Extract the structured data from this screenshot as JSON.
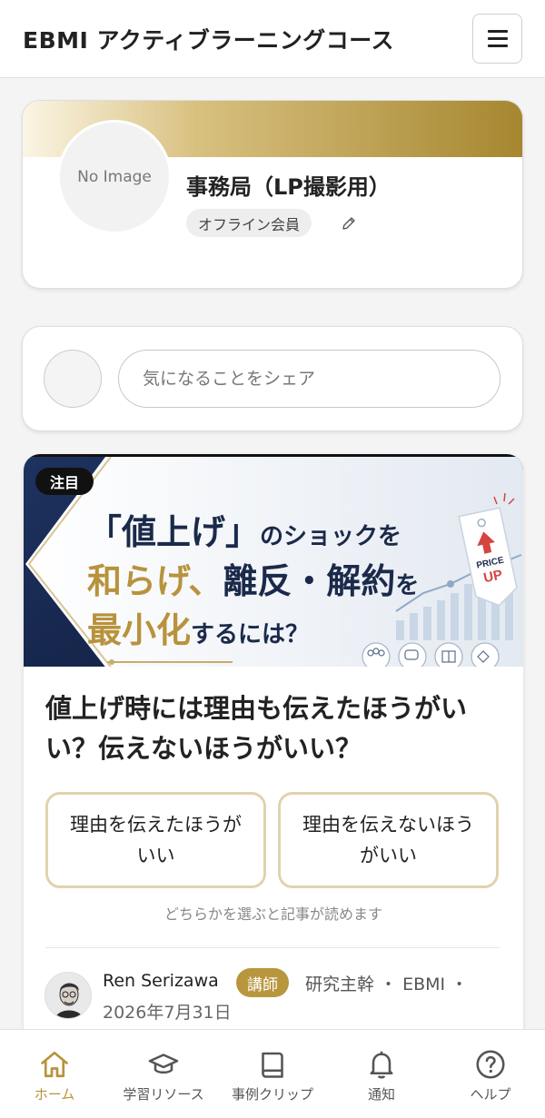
{
  "header": {
    "title": "EBMI アクティブラーニングコース"
  },
  "profile": {
    "avatar_text": "No Image",
    "name": "事務局（LP撮影用）",
    "member_type": "オフライン会員"
  },
  "share": {
    "placeholder": "気になることをシェア"
  },
  "article": {
    "badge": "注目",
    "hero": {
      "line1_a": "「値上げ」",
      "line1_b": "のショックを",
      "line2_a": "和らげ、",
      "line2_b": "離反・解約",
      "line2_c": "を",
      "line3_a": "最小化",
      "line3_b": "するには？",
      "tag_top": "PRICE",
      "tag_bottom": "UP"
    },
    "title": "値上げ時には理由も伝えたほうがいい？伝えないほうがいい？",
    "choice_a": "理由を伝えたほうがいい",
    "choice_b": "理由を伝えないほうがいい",
    "choice_note": "どちらかを選ぶと記事が読めます",
    "author": {
      "name": "Ren Serizawa",
      "role": "講師",
      "org": "研究主幹 ・ EBMI ・",
      "date": "2026年7月31日"
    }
  },
  "nav": {
    "items": [
      {
        "label": "ホーム",
        "icon": "home-icon"
      },
      {
        "label": "学習リソース",
        "icon": "graduation-cap-icon"
      },
      {
        "label": "事例クリップ",
        "icon": "book-icon"
      },
      {
        "label": "通知",
        "icon": "bell-icon"
      },
      {
        "label": "ヘルプ",
        "icon": "help-circle-icon"
      }
    ]
  },
  "colors": {
    "accent_gold": "#b8923c",
    "navy": "#1b2a4a"
  }
}
